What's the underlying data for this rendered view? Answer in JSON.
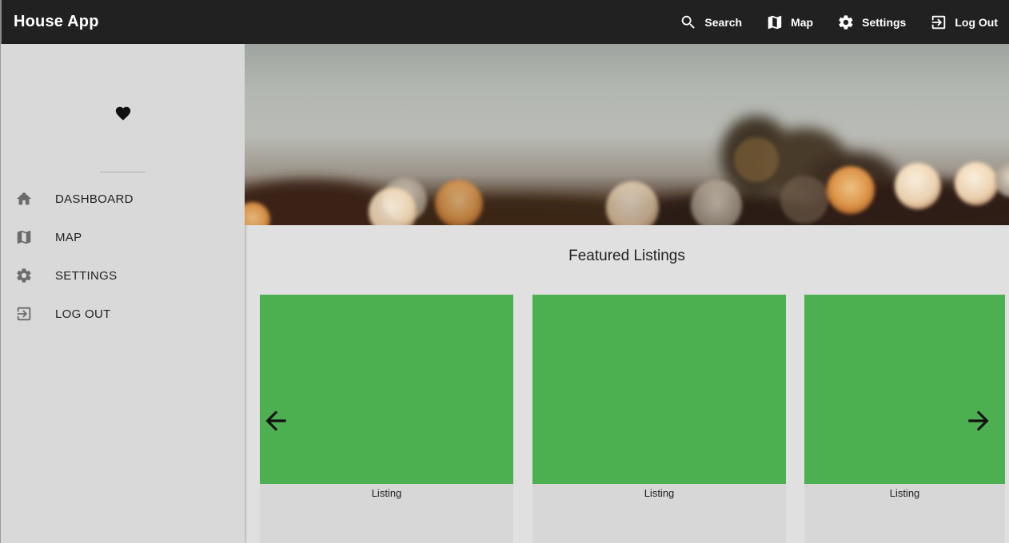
{
  "app": {
    "title": "House App"
  },
  "topbar": {
    "actions": [
      {
        "label": "Search",
        "icon": "search-icon"
      },
      {
        "label": "Map",
        "icon": "map-icon"
      },
      {
        "label": "Settings",
        "icon": "gear-icon"
      },
      {
        "label": "Log Out",
        "icon": "logout-icon"
      }
    ]
  },
  "sidebar": {
    "items": [
      {
        "label": "DASHBOARD",
        "icon": "home-icon"
      },
      {
        "label": "MAP",
        "icon": "map-icon"
      },
      {
        "label": "SETTINGS",
        "icon": "gear-icon"
      },
      {
        "label": "LOG OUT",
        "icon": "logout-icon"
      }
    ]
  },
  "featured": {
    "title": "Featured Listings",
    "listings": [
      {
        "label": "Listing"
      },
      {
        "label": "Listing"
      },
      {
        "label": "Listing"
      }
    ]
  },
  "colors": {
    "topbar": "#212121",
    "sidebar": "#d9d9d9",
    "listing_image": "#4caf50",
    "page_background": "#e0e0e0"
  }
}
